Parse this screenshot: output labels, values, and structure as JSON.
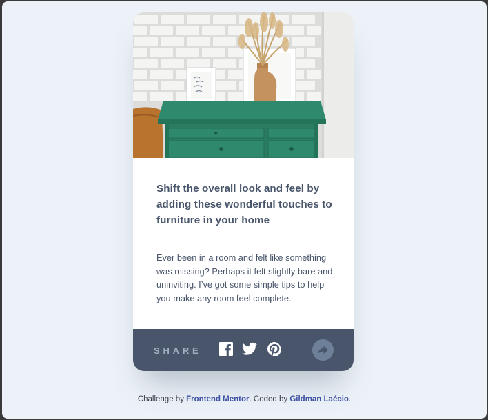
{
  "card": {
    "title": "Shift the overall look and feel by adding these wonderful touches to furniture in your home",
    "description": "Ever been in a room and felt like something was missing? Perhaps it felt slightly bare and uninviting. I’ve got some simple tips to help you make any room feel complete.",
    "share_label": "SHARE",
    "share_icons": [
      "facebook-icon",
      "twitter-icon",
      "pinterest-icon",
      "share-arrow-icon"
    ]
  },
  "attribution": {
    "prefix": "Challenge by ",
    "challenge_link": "Frontend Mentor",
    "middle": ". Coded by ",
    "author_link": "Gildman Laécio",
    "suffix": "."
  },
  "colors": {
    "background": "#ecf2f8",
    "card": "#ffffff",
    "share_bar": "#48556a",
    "text": "#48556a",
    "share_label": "#9eafc2",
    "share_button": "#6e8098",
    "link": "#3e52a3"
  }
}
